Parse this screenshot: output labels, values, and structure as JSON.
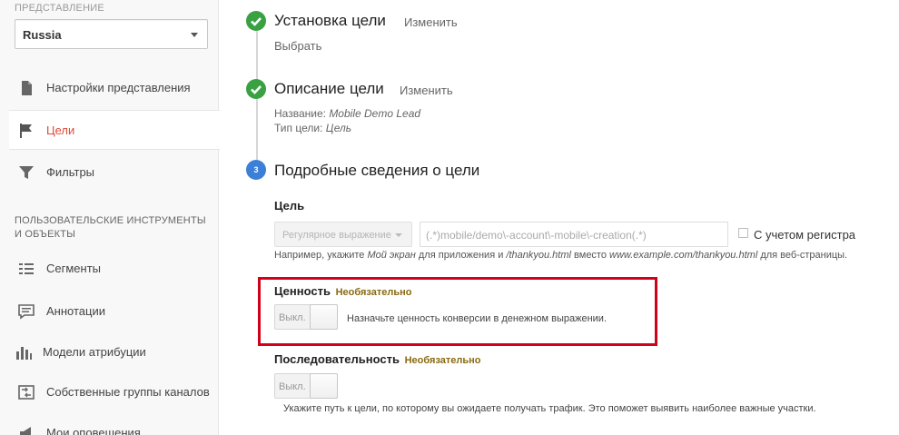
{
  "sidebar": {
    "view_label": "ПРЕДСТАВЛЕНИЕ",
    "view_select": "Russia",
    "items": [
      {
        "label": "Настройки представления",
        "icon": "document-icon"
      },
      {
        "label": "Цели",
        "icon": "flag-icon"
      },
      {
        "label": "Фильтры",
        "icon": "filter-icon"
      }
    ],
    "section_heading": "ПОЛЬЗОВАТЕЛЬСКИЕ ИНСТРУМЕНТЫ И ОБЪЕКТЫ",
    "tools": [
      {
        "label": "Сегменты",
        "icon": "segments-icon"
      },
      {
        "label": "Аннотации",
        "icon": "annotation-icon"
      },
      {
        "label": "Модели атрибуции",
        "icon": "bar-chart-icon"
      },
      {
        "label": "Собственные группы каналов",
        "icon": "channels-icon"
      },
      {
        "label": "Мои оповещения",
        "icon": "megaphone-icon"
      }
    ],
    "active_color": "#dd4b39"
  },
  "steps": {
    "step1": {
      "title": "Установка цели",
      "edit": "Изменить",
      "sub": "Выбрать"
    },
    "step2": {
      "title": "Описание цели",
      "edit": "Изменить",
      "name_label": "Название:",
      "name_value": "Mobile Demo Lead",
      "type_label": "Тип цели:",
      "type_value": "Цель"
    },
    "step3": {
      "number": "3",
      "title": "Подробные сведения о цели"
    }
  },
  "goal": {
    "label": "Цель",
    "match_type": "Регулярное выражение",
    "url_value": "(.*)mobile/demo\\-account\\-mobile\\-creation(.*)",
    "case_label": "С учетом регистра",
    "hint_prefix": "Например, укажите",
    "hint_em1": "Мой экран",
    "hint_mid1": "для приложения и",
    "hint_em2": "/thankyou.html",
    "hint_mid2": "вместо",
    "hint_em3": "www.example.com/thankyou.html",
    "hint_suffix": "для веб-страницы."
  },
  "value": {
    "label": "Ценность",
    "optional": "Необязательно",
    "toggle_off": "Выкл.",
    "description": "Назначьте ценность конверсии в денежном выражении."
  },
  "funnel": {
    "label": "Последовательность",
    "optional": "Необязательно",
    "toggle_off": "Выкл.",
    "description": "Укажите путь к цели, по которому вы ожидаете получать трафик. Это поможет выявить наиболее важные участки."
  },
  "colors": {
    "done": "#3aa142",
    "current": "#3b7fd8",
    "highlight": "#d0021b"
  }
}
